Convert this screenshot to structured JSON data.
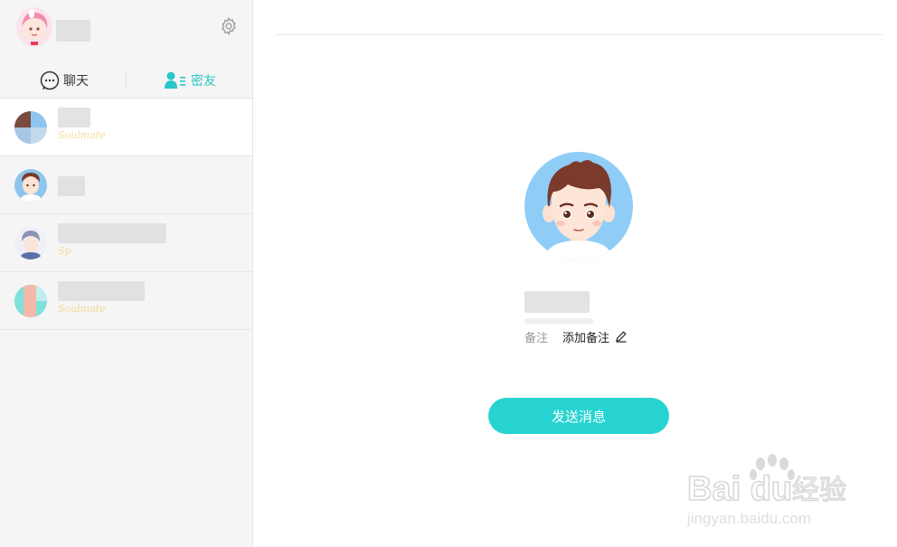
{
  "tabs": [
    {
      "label": "聊天",
      "icon": "chat-bubble-icon",
      "active": false
    },
    {
      "label": "密友",
      "icon": "friends-icon",
      "active": true
    }
  ],
  "contacts": [
    {
      "subtitle": "Soulmate",
      "active": true
    },
    {
      "subtitle": "",
      "active": false
    },
    {
      "subtitle": "Sp",
      "active": false
    },
    {
      "subtitle": "Soulmate",
      "active": false
    }
  ],
  "profile": {
    "remark_label": "备注",
    "remark_add": "添加备注",
    "send_button": "发送消息"
  },
  "watermark": {
    "brand": "Bai du",
    "suffix": "经验",
    "url": "jingyan.baidu.com"
  },
  "colors": {
    "accent": "#26d3d0",
    "active_tab": "#29c6c6",
    "sidebar_bg": "#f5f5f5"
  }
}
